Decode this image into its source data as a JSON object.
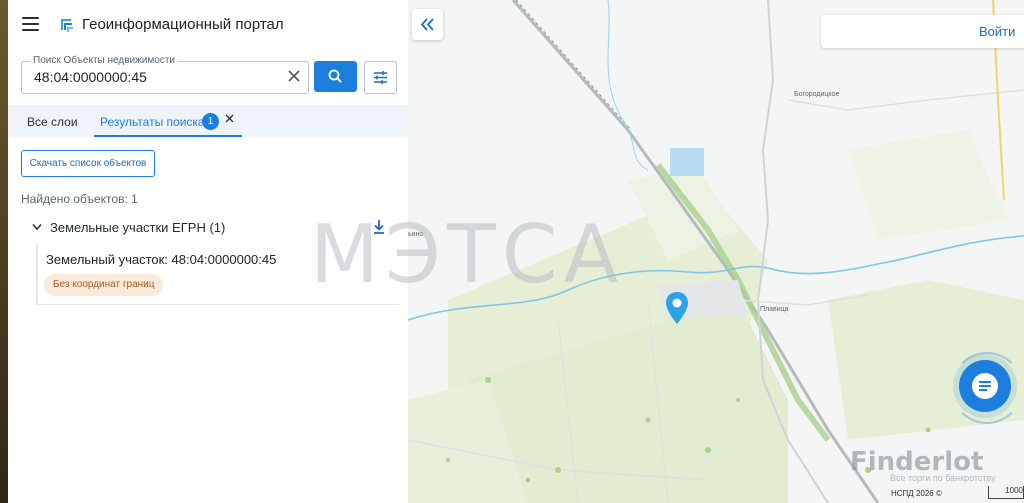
{
  "app": {
    "title": "Геоинформационный портал"
  },
  "search": {
    "label": "Поиск Объекты недвижимости",
    "value": "48:04:0000000:45"
  },
  "tabs": [
    {
      "label": "Все слои"
    },
    {
      "label": "Результаты поиска",
      "badge": "1"
    }
  ],
  "actions": {
    "download_label": "Скачать список объектов"
  },
  "results": {
    "found_text": "Найдено объектов: 1",
    "group_label": "Земельные участки ЕГРН (1)",
    "item_title": "Земельный участок: 48:04:0000000:45",
    "item_tag": "Без координат границ"
  },
  "map": {
    "login_label": "Войти",
    "copyright": "НСПД 2026 ©",
    "scale_label": "1000",
    "places": [
      "Богородицкое",
      "Плавица",
      "ьино"
    ]
  },
  "watermarks": {
    "center": "МЭТСА",
    "corner": "Finderlot",
    "corner_sub": "Все торги по банкротству"
  },
  "colors": {
    "accent": "#1c7fe0",
    "tag_bg": "#fbe9da",
    "tag_text": "#a85b22"
  }
}
